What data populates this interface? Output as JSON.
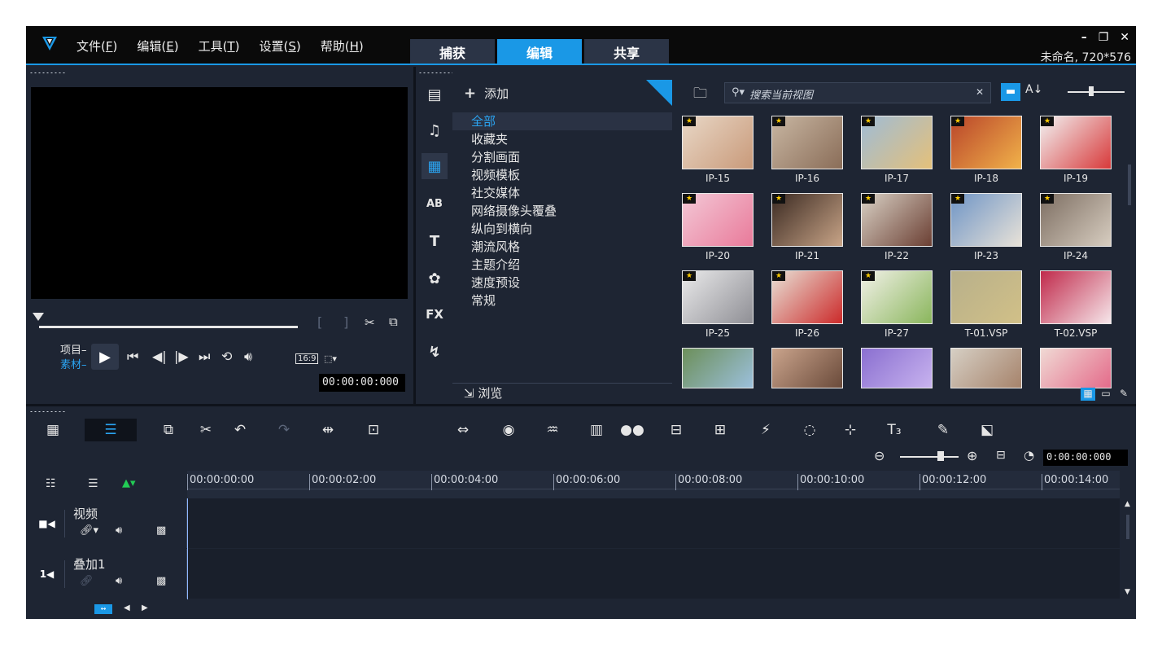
{
  "menu": {
    "file": "文件(",
    "file_key": "F",
    "edit": "编辑(",
    "edit_key": "E",
    "tools": "工具(",
    "tools_key": "T",
    "settings": "设置(",
    "settings_key": "S",
    "help": "帮助(",
    "help_key": "H",
    "close_paren": ")"
  },
  "tabs": [
    "捕获",
    "编辑",
    "共享"
  ],
  "active_tab": "编辑",
  "project_info": "未命名, 720*576",
  "player": {
    "project_label": "项目–",
    "clip_label": "素材–",
    "aspect": "16:9",
    "timecode": "00:00:00:000"
  },
  "library": {
    "add_label": "添加",
    "categories": [
      "全部",
      "收藏夹",
      "分割画面",
      "视频模板",
      "社交媒体",
      "网络摄像头覆叠",
      "纵向到横向",
      "潮流风格",
      "主题介绍",
      "速度预设",
      "常规"
    ],
    "active_category": "全部",
    "browse_label": "浏览",
    "search_placeholder": "搜索当前视图"
  },
  "gallery": [
    {
      "label": "IP-15",
      "star": true
    },
    {
      "label": "IP-16",
      "star": true
    },
    {
      "label": "IP-17",
      "star": true
    },
    {
      "label": "IP-18",
      "star": true
    },
    {
      "label": "IP-19",
      "star": true
    },
    {
      "label": "IP-20",
      "star": true
    },
    {
      "label": "IP-21",
      "star": true
    },
    {
      "label": "IP-22",
      "star": true
    },
    {
      "label": "IP-23",
      "star": true
    },
    {
      "label": "IP-24",
      "star": true
    },
    {
      "label": "IP-25",
      "star": true
    },
    {
      "label": "IP-26",
      "star": true
    },
    {
      "label": "IP-27",
      "star": true
    },
    {
      "label": "T-01.VSP",
      "star": false
    },
    {
      "label": "T-02.VSP",
      "star": false
    },
    {
      "label": "",
      "star": false
    },
    {
      "label": "",
      "star": false
    },
    {
      "label": "",
      "star": false
    },
    {
      "label": "",
      "star": false
    },
    {
      "label": "",
      "star": false
    }
  ],
  "timeline": {
    "timecode": "0:00:00:000",
    "ruler": [
      "00:00:00:00",
      "00:00:02:00",
      "00:00:04:00",
      "00:00:06:00",
      "00:00:08:00",
      "00:00:10:00",
      "00:00:12:00",
      "00:00:14:00"
    ],
    "tracks": [
      {
        "name": "视频"
      },
      {
        "name": "叠加1"
      }
    ]
  },
  "colors": {
    "accent": "#1a98e6",
    "panel": "#1e2533",
    "titlebar": "#0a0a0a"
  }
}
